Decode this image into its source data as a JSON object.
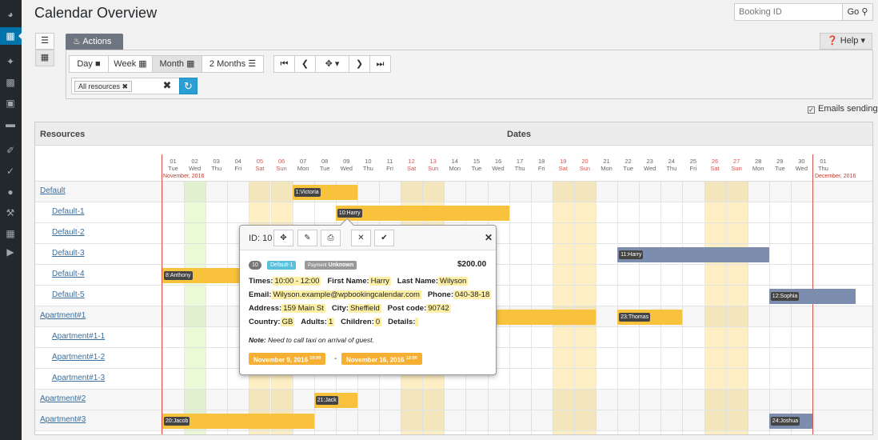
{
  "page_title": "Calendar Overview",
  "search": {
    "placeholder": "Booking ID",
    "go_label": "Go"
  },
  "sidebar_icons": [
    "dashboard-icon",
    "calendar-icon",
    "pin-icon",
    "resources-icon",
    "pages-icon",
    "comments-icon",
    "appearance-icon",
    "plugins-icon",
    "users-icon",
    "tools-icon",
    "settings-icon",
    "play-icon"
  ],
  "actions_label": "Actions",
  "help_label": "Help",
  "views": {
    "day": "Day",
    "week": "Week",
    "month": "Month",
    "two_months": "2 Months"
  },
  "resources_filter": {
    "chip": "All resources"
  },
  "emails_sending": "Emails sending",
  "calendar": {
    "resources_header": "Resources",
    "dates_header": "Dates",
    "month_start": "November, 2016",
    "month_end": "December, 2016",
    "days": [
      {
        "d": "01",
        "w": "Tue"
      },
      {
        "d": "02",
        "w": "Wed"
      },
      {
        "d": "03",
        "w": "Thu"
      },
      {
        "d": "04",
        "w": "Fri"
      },
      {
        "d": "05",
        "w": "Sat"
      },
      {
        "d": "06",
        "w": "Sun"
      },
      {
        "d": "07",
        "w": "Mon"
      },
      {
        "d": "08",
        "w": "Tue"
      },
      {
        "d": "09",
        "w": "Wed"
      },
      {
        "d": "10",
        "w": "Thu"
      },
      {
        "d": "11",
        "w": "Fri"
      },
      {
        "d": "12",
        "w": "Sat"
      },
      {
        "d": "13",
        "w": "Sun"
      },
      {
        "d": "14",
        "w": "Mon"
      },
      {
        "d": "15",
        "w": "Tue"
      },
      {
        "d": "16",
        "w": "Wed"
      },
      {
        "d": "17",
        "w": "Thu"
      },
      {
        "d": "18",
        "w": "Fri"
      },
      {
        "d": "19",
        "w": "Sat"
      },
      {
        "d": "20",
        "w": "Sun"
      },
      {
        "d": "21",
        "w": "Mon"
      },
      {
        "d": "22",
        "w": "Tue"
      },
      {
        "d": "23",
        "w": "Wed"
      },
      {
        "d": "24",
        "w": "Thu"
      },
      {
        "d": "25",
        "w": "Fri"
      },
      {
        "d": "26",
        "w": "Sat"
      },
      {
        "d": "27",
        "w": "Sun"
      },
      {
        "d": "28",
        "w": "Mon"
      },
      {
        "d": "29",
        "w": "Tue"
      },
      {
        "d": "30",
        "w": "Wed"
      },
      {
        "d": "01",
        "w": "Thu"
      }
    ],
    "resources": [
      {
        "name": "Default",
        "level": 0
      },
      {
        "name": "Default-1",
        "level": 1
      },
      {
        "name": "Default-2",
        "level": 1
      },
      {
        "name": "Default-3",
        "level": 1
      },
      {
        "name": "Default-4",
        "level": 1
      },
      {
        "name": "Default-5",
        "level": 1
      },
      {
        "name": "Apartment#1",
        "level": 0
      },
      {
        "name": "Apartment#1-1",
        "level": 1
      },
      {
        "name": "Apartment#1-2",
        "level": 1
      },
      {
        "name": "Apartment#1-3",
        "level": 1
      },
      {
        "name": "Apartment#2",
        "level": 0
      },
      {
        "name": "Apartment#3",
        "level": 0
      }
    ],
    "bookings": [
      {
        "label": "1:Victoria",
        "row": 0,
        "start": 6,
        "len": 3,
        "color": "y"
      },
      {
        "label": "10:Harry",
        "row": 1,
        "start": 8,
        "len": 8,
        "color": "y"
      },
      {
        "label": "11:Harry",
        "row": 3,
        "start": 21,
        "len": 7,
        "color": "b"
      },
      {
        "label": "8:Anthony",
        "row": 4,
        "start": 0,
        "len": 4,
        "color": "y"
      },
      {
        "label": "12:Sophia",
        "row": 5,
        "start": 28,
        "len": 4,
        "color": "b"
      },
      {
        "label": "",
        "row": 6,
        "start": 15,
        "len": 5,
        "color": "y"
      },
      {
        "label": "23:Thomas",
        "row": 6,
        "start": 21,
        "len": 3,
        "color": "y"
      },
      {
        "label": "21:Jack",
        "row": 10,
        "start": 7,
        "len": 2,
        "color": "y"
      },
      {
        "label": "20:Jacob",
        "row": 11,
        "start": 0,
        "len": 7,
        "color": "y"
      },
      {
        "label": "24:Joshua",
        "row": 11,
        "start": 28,
        "len": 2,
        "color": "b"
      }
    ]
  },
  "popover": {
    "id_label": "ID: 10",
    "badge_id": "10",
    "badge_resource": "Default-1",
    "badge_payment_prefix": "Payment",
    "badge_payment": "Unknown",
    "price": "$200.00",
    "times_label": "Times:",
    "times": "10:00 - 12:00",
    "first_name_label": "First Name:",
    "first_name": "Harry",
    "last_name_label": "Last Name:",
    "last_name": "Wilyson",
    "email_label": "Email:",
    "email": "Wilyson.example@wpbookingcalendar.com",
    "phone_label": "Phone:",
    "phone": "040-38-18",
    "address_label": "Address:",
    "address": "159 Main St",
    "city_label": "City:",
    "city": "Sheffield",
    "postcode_label": "Post code:",
    "postcode": "90742",
    "country_label": "Country:",
    "country": "GB",
    "adults_label": "Adults:",
    "adults": "1",
    "children_label": "Children:",
    "children": "0",
    "details_label": "Details:",
    "details": "",
    "note_label": "Note:",
    "note": "Need to call taxi on arrival of guest.",
    "date_from": "November 9, 2016",
    "time_from": "10:00",
    "date_to": "November 16, 2016",
    "time_to": "12:00",
    "dash": "-"
  }
}
